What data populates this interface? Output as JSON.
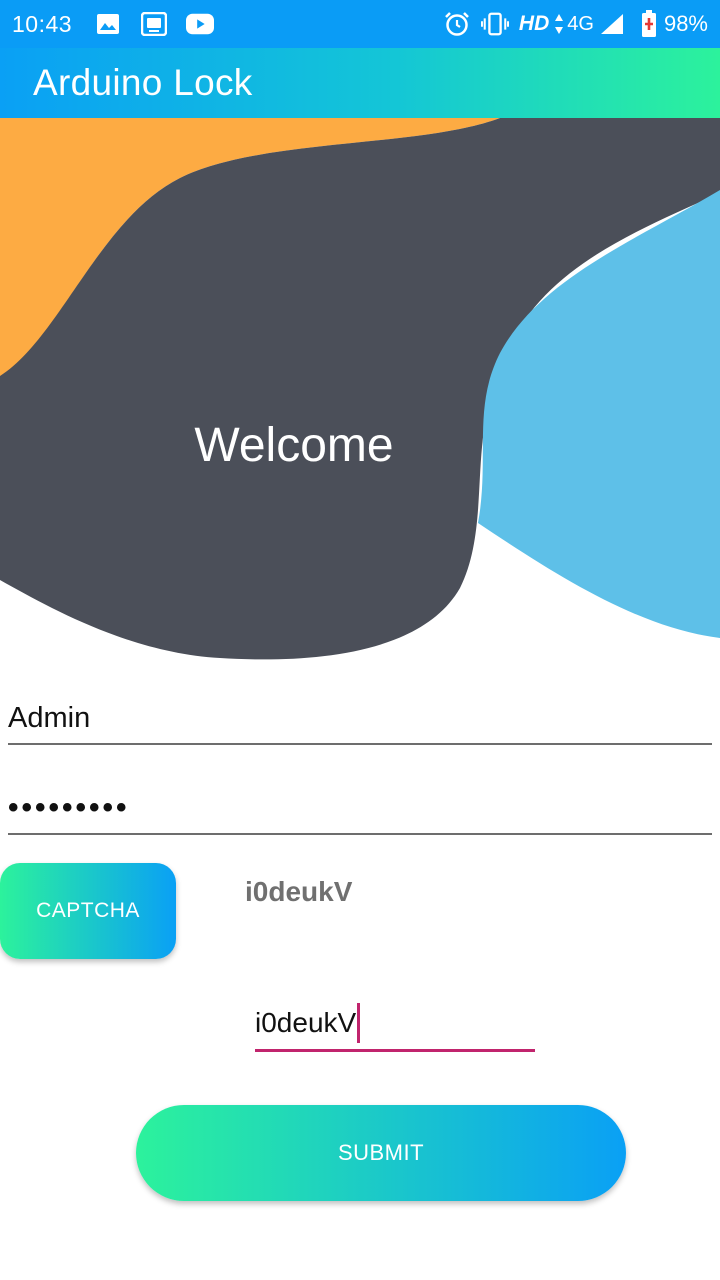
{
  "status_bar": {
    "time": "10:43",
    "left_icons": [
      "image-icon",
      "screen-record-icon",
      "youtube-icon"
    ],
    "right_icons": [
      "alarm-icon",
      "vibrate-icon",
      "signal-icon",
      "battery-charging-icon"
    ],
    "hd": "HD",
    "network": "4G",
    "battery": "98%"
  },
  "app_bar": {
    "title": "Arduino Lock"
  },
  "hero": {
    "welcome": "Welcome",
    "colors": {
      "orange": "#fdab43",
      "dark": "#4b4f59",
      "blue": "#5ec0e8"
    }
  },
  "form": {
    "username_value": "Admin",
    "password_value": "•••••••••",
    "captcha_button": "CAPTCHA",
    "captcha_code": "i0deukV",
    "captcha_input_value": "i0deukV",
    "submit_button": "SUBMIT"
  },
  "colors": {
    "status_bar": "#0a9cf6",
    "gradient_start": "#2cf29c",
    "gradient_end": "#0aa0f5",
    "focus_underline": "#c1246d"
  }
}
